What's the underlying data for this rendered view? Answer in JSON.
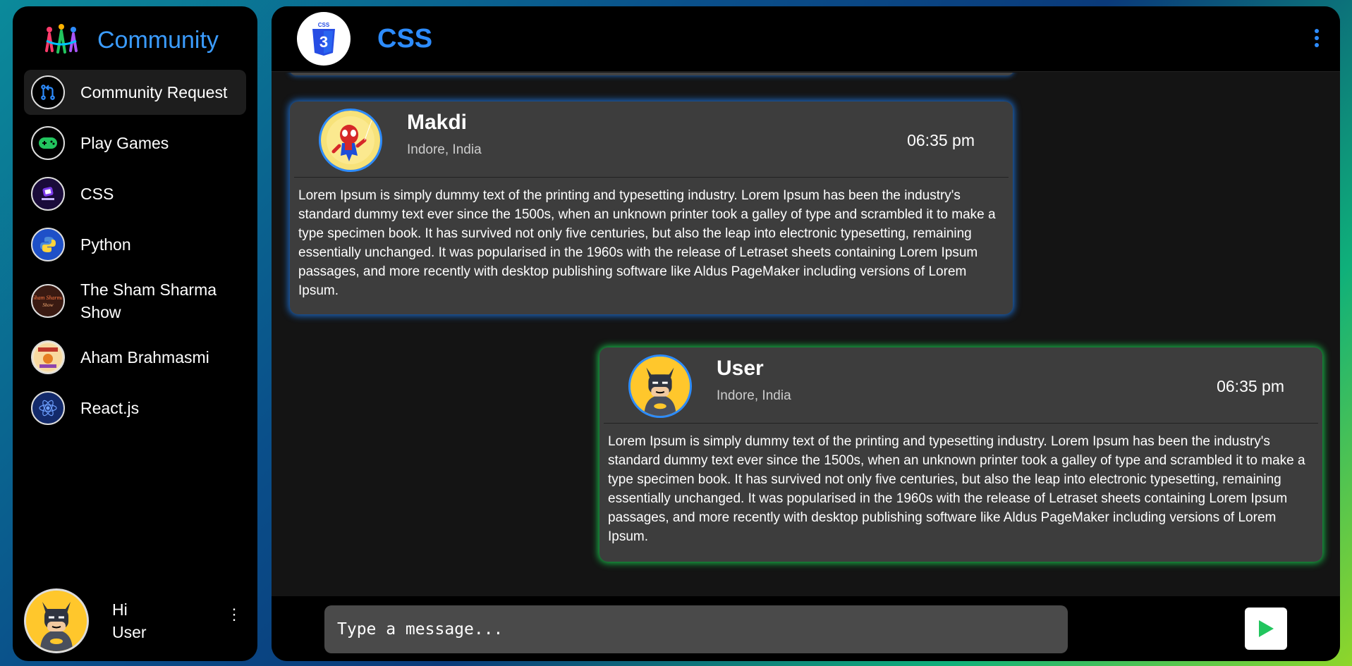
{
  "sidebar": {
    "brand": "Community",
    "items": [
      {
        "label": "Community Request",
        "icon": "pull-request-icon"
      },
      {
        "label": "Play Games",
        "icon": "gamepad-icon"
      },
      {
        "label": "CSS",
        "icon": "coding-logo-icon"
      },
      {
        "label": "Python",
        "icon": "python-logo-icon"
      },
      {
        "label": "The Sham Sharma Show",
        "icon": "show-logo-icon"
      },
      {
        "label": "Aham Brahmasmi",
        "icon": "aham-brahmasmi-icon"
      },
      {
        "label": "React.js",
        "icon": "react-logo-icon"
      }
    ],
    "profile": {
      "greeting": "Hi",
      "name": "User"
    }
  },
  "header": {
    "title": "CSS"
  },
  "messages": [
    {
      "name": "Makdi",
      "location": "Indore, India",
      "time": "06:35 pm",
      "text": "Lorem Ipsum is simply dummy text of the printing and typesetting industry. Lorem Ipsum has been the industry's standard dummy text ever since the 1500s, when an unknown printer took a galley of type and scrambled it to make a type specimen book. It has survived not only five centuries, but also the leap into electronic typesetting, remaining essentially unchanged. It was popularised in the 1960s with the release of Letraset sheets containing Lorem Ipsum passages, and more recently with desktop publishing software like Aldus PageMaker including versions of Lorem Ipsum."
    },
    {
      "name": "User",
      "location": "Indore, India",
      "time": "06:35 pm",
      "text": "Lorem Ipsum is simply dummy text of the printing and typesetting industry. Lorem Ipsum has been the industry's standard dummy text ever since the 1500s, when an unknown printer took a galley of type and scrambled it to make a type specimen book. It has survived not only five centuries, but also the leap into electronic typesetting, remaining essentially unchanged. It was popularised in the 1960s with the release of Letraset sheets containing Lorem Ipsum passages, and more recently with desktop publishing software like Aldus PageMaker including versions of Lorem Ipsum."
    }
  ],
  "composer": {
    "placeholder": "Type a message...",
    "badge_text": "CSS"
  },
  "colors": {
    "accent": "#2d8cff",
    "sent_glow": "#19c04b",
    "received_glow": "#1e6fd0"
  }
}
